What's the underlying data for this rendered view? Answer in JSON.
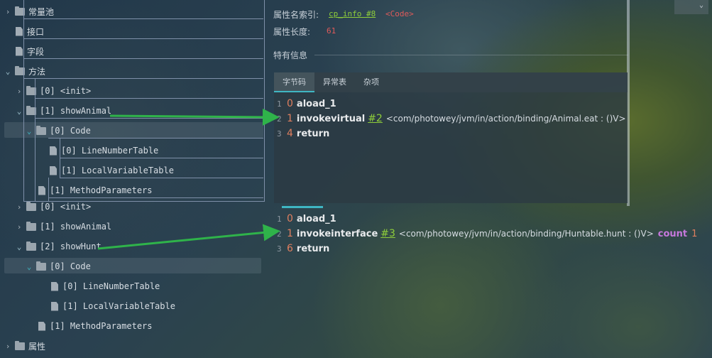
{
  "tree_top": {
    "constant_pool": "常量池",
    "interfaces": "接口",
    "fields": "字段",
    "methods": "方法",
    "method_init": "[0] <init>",
    "method_show_animal": "[1] showAnimal",
    "code": "[0] Code",
    "line_number_table": "[0] LineNumberTable",
    "local_variable_table": "[1] LocalVariableTable",
    "method_parameters": "[1] MethodParameters"
  },
  "tree_bottom": {
    "method_init": "[0] <init>",
    "method_show_animal": "[1] showAnimal",
    "method_show_hunt": "[2] showHunt",
    "code": "[0] Code",
    "line_number_table": "[0] LineNumberTable",
    "local_variable_table": "[1] LocalVariableTable",
    "method_parameters": "[1] MethodParameters",
    "attributes": "属性"
  },
  "attributes_panel": {
    "name_index_label": "属性名索引:",
    "name_index_value": "cp_info #8",
    "name_index_tag": "<Code>",
    "length_label": "属性长度:",
    "length_value": "61",
    "specific_info": "特有信息"
  },
  "tabs": [
    "字节码",
    "异常表",
    "杂项"
  ],
  "code_top": [
    {
      "line": "1",
      "offset": "0",
      "op": "aload_1",
      "ref": "",
      "sig": "",
      "extra_kw": "",
      "extra_num": ""
    },
    {
      "line": "2",
      "offset": "1",
      "op": "invokevirtual",
      "ref": "#2",
      "sig": "<com/photowey/jvm/in/action/binding/Animal.eat : ()V>",
      "extra_kw": "",
      "extra_num": ""
    },
    {
      "line": "3",
      "offset": "4",
      "op": "return",
      "ref": "",
      "sig": "",
      "extra_kw": "",
      "extra_num": ""
    }
  ],
  "code_bottom": [
    {
      "line": "1",
      "offset": "0",
      "op": "aload_1",
      "ref": "",
      "sig": "",
      "extra_kw": "",
      "extra_num": ""
    },
    {
      "line": "2",
      "offset": "1",
      "op": "invokeinterface",
      "ref": "#3",
      "sig": "<com/photowey/jvm/in/action/binding/Huntable.hunt : ()V>",
      "extra_kw": "count",
      "extra_num": "1"
    },
    {
      "line": "3",
      "offset": "6",
      "op": "return",
      "ref": "",
      "sig": "",
      "extra_kw": "",
      "extra_num": ""
    }
  ],
  "colors": {
    "accent_teal": "#3fb6c3",
    "arrow_green": "#2fb34a",
    "offset_orange": "#e07f5f",
    "ref_green": "#8fce3a",
    "keyword_purple": "#c678dd"
  }
}
